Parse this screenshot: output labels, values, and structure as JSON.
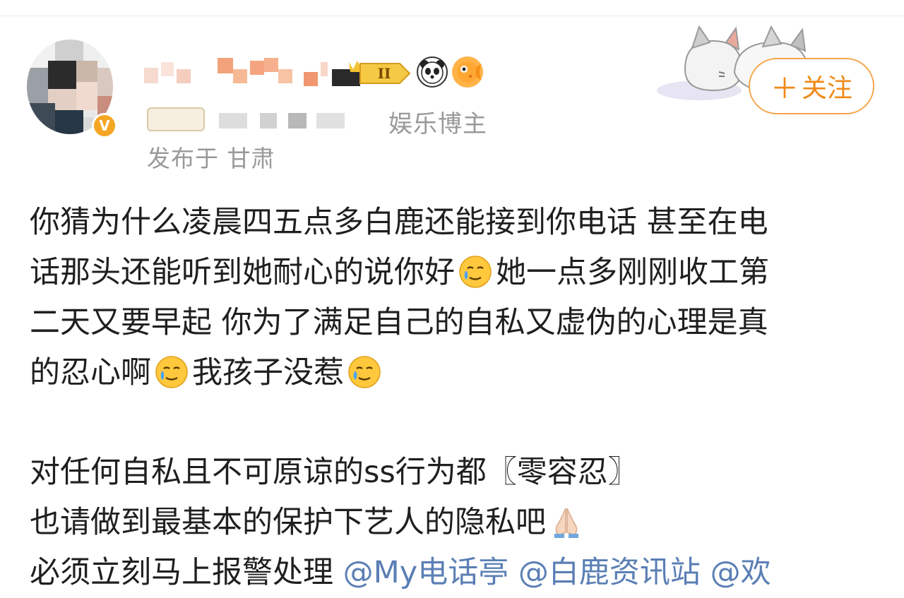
{
  "user": {
    "role": "娱乐博主",
    "location": "发布于 甘肃",
    "level_badge": "II"
  },
  "follow_button": {
    "icon": "plus-icon",
    "label": "关注"
  },
  "post": {
    "lines_a": [
      "你猜为什么凌晨四五点多白鹿还能接到你电话 甚至在电",
      "话那头还能听到她耐心的说你好",
      "她一点多刚刚收工第",
      "二天又要早起 你为了满足自己的自私又虚伪的心理是真",
      "的忍心啊",
      "我孩子没惹"
    ],
    "lines_b": [
      "对任何自私且不可原谅的ss行为都〖零容忍〗",
      "也请做到最基本的保护下艺人的隐私吧",
      "必须立刻马上报警处理"
    ],
    "mentions": [
      "@My电话亭",
      "@白鹿资讯站",
      "@欢"
    ]
  },
  "colors": {
    "accent": "#f08a18",
    "mention": "#5b7fb5",
    "muted_text": "#999999"
  }
}
